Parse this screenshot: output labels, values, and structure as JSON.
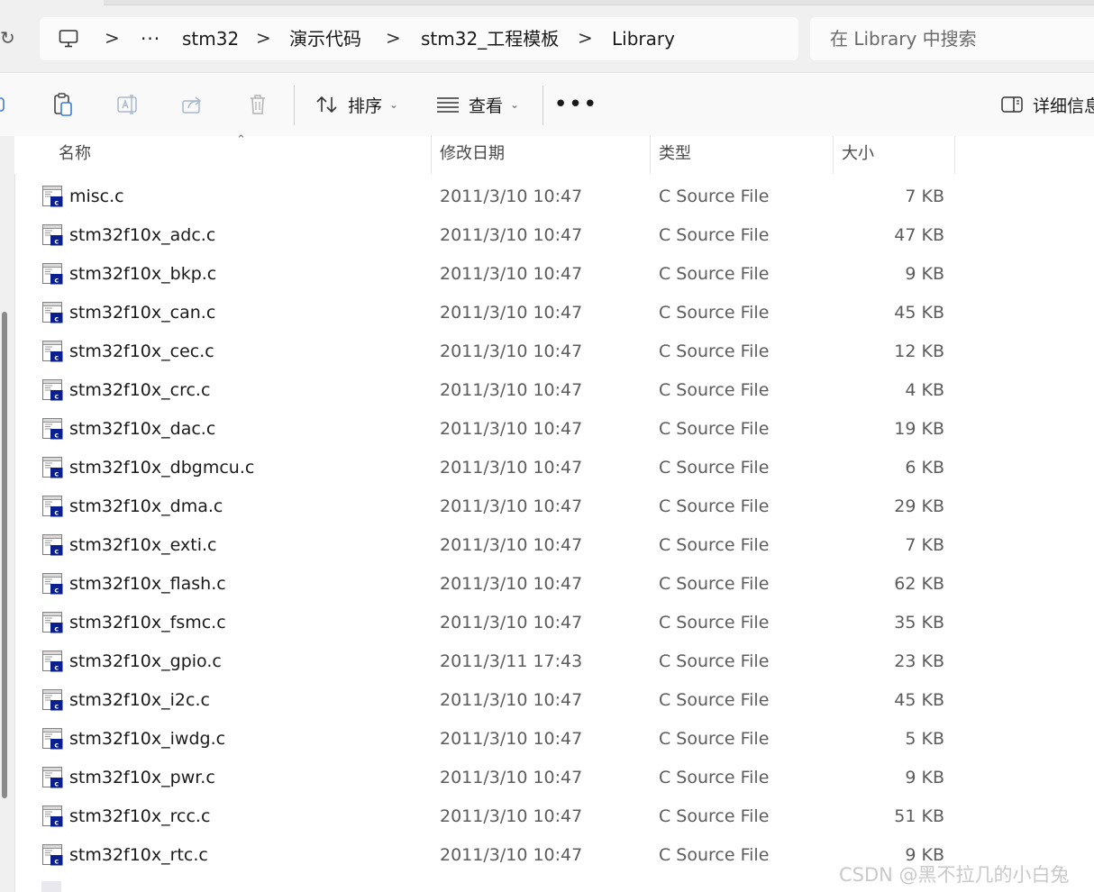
{
  "window": {
    "refresh_glyph": "↻"
  },
  "address": {
    "ellipsis": "···",
    "separator": ">",
    "crumbs": [
      "stm32",
      "演示代码",
      "stm32_工程模板",
      "Library"
    ]
  },
  "search": {
    "placeholder": "在 Library 中搜索"
  },
  "toolbar": {
    "sort_label": "排序",
    "view_label": "查看",
    "more_label": "•••",
    "details_label": "详细信息"
  },
  "columns": {
    "name": "名称",
    "modified": "修改日期",
    "type": "类型",
    "size": "大小"
  },
  "files": [
    {
      "name": "misc.c",
      "modified": "2011/3/10 10:47",
      "type": "C Source File",
      "size": "7 KB"
    },
    {
      "name": "stm32f10x_adc.c",
      "modified": "2011/3/10 10:47",
      "type": "C Source File",
      "size": "47 KB"
    },
    {
      "name": "stm32f10x_bkp.c",
      "modified": "2011/3/10 10:47",
      "type": "C Source File",
      "size": "9 KB"
    },
    {
      "name": "stm32f10x_can.c",
      "modified": "2011/3/10 10:47",
      "type": "C Source File",
      "size": "45 KB"
    },
    {
      "name": "stm32f10x_cec.c",
      "modified": "2011/3/10 10:47",
      "type": "C Source File",
      "size": "12 KB"
    },
    {
      "name": "stm32f10x_crc.c",
      "modified": "2011/3/10 10:47",
      "type": "C Source File",
      "size": "4 KB"
    },
    {
      "name": "stm32f10x_dac.c",
      "modified": "2011/3/10 10:47",
      "type": "C Source File",
      "size": "19 KB"
    },
    {
      "name": "stm32f10x_dbgmcu.c",
      "modified": "2011/3/10 10:47",
      "type": "C Source File",
      "size": "6 KB"
    },
    {
      "name": "stm32f10x_dma.c",
      "modified": "2011/3/10 10:47",
      "type": "C Source File",
      "size": "29 KB"
    },
    {
      "name": "stm32f10x_exti.c",
      "modified": "2011/3/10 10:47",
      "type": "C Source File",
      "size": "7 KB"
    },
    {
      "name": "stm32f10x_flash.c",
      "modified": "2011/3/10 10:47",
      "type": "C Source File",
      "size": "62 KB"
    },
    {
      "name": "stm32f10x_fsmc.c",
      "modified": "2011/3/10 10:47",
      "type": "C Source File",
      "size": "35 KB"
    },
    {
      "name": "stm32f10x_gpio.c",
      "modified": "2011/3/11 17:43",
      "type": "C Source File",
      "size": "23 KB"
    },
    {
      "name": "stm32f10x_i2c.c",
      "modified": "2011/3/10 10:47",
      "type": "C Source File",
      "size": "45 KB"
    },
    {
      "name": "stm32f10x_iwdg.c",
      "modified": "2011/3/10 10:47",
      "type": "C Source File",
      "size": "5 KB"
    },
    {
      "name": "stm32f10x_pwr.c",
      "modified": "2011/3/10 10:47",
      "type": "C Source File",
      "size": "9 KB"
    },
    {
      "name": "stm32f10x_rcc.c",
      "modified": "2011/3/10 10:47",
      "type": "C Source File",
      "size": "51 KB"
    },
    {
      "name": "stm32f10x_rtc.c",
      "modified": "2011/3/10 10:47",
      "type": "C Source File",
      "size": "9 KB"
    }
  ],
  "watermark": "CSDN @黑不拉几的小白兔",
  "icons": {
    "this_pc": "monitor-icon",
    "file": "c-source-file-icon",
    "copy": "copy-icon",
    "rename": "rename-icon",
    "share": "share-icon",
    "delete": "trash-icon",
    "sort": "sort-icon",
    "view": "view-list-icon",
    "details": "details-pane-icon"
  },
  "colors": {
    "accent": "#0a1f8f",
    "page_bg": "#ffffff",
    "chrome_bg": "#f3f3f3"
  }
}
